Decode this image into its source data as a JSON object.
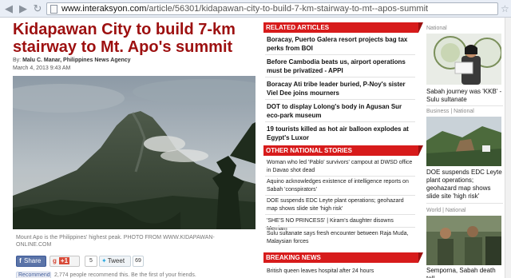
{
  "browser": {
    "url_host": "www.interaksyon.com",
    "url_path": "/article/56301/kidapawan-city-to-build-7-km-stairway-to-mt--apos-summit"
  },
  "article": {
    "headline": "Kidapawan City to build 7-km stairway to Mt. Apo's summit",
    "byline_prefix": "By:",
    "byline_author": "Malu C. Manar, Philippines News Agency",
    "date": "March 4, 2013 9:43 AM",
    "photo_caption": "Mount Apo is the Philippines' highest peak. PHOTO FROM WWW.KIDAPAWAN-ONLINE.COM"
  },
  "social": {
    "fb_share_label": "Share",
    "gplus_label": "+1",
    "gplus_count": "5",
    "tweet_label": "Tweet",
    "tweet_count": "69",
    "recommend_label": "Recommend",
    "recommend_text": "2,774 people recommend this. Be the first of your friends."
  },
  "related": {
    "header": "RELATED ARTICLES",
    "items": [
      "Boracay, Puerto Galera resort projects bag tax perks from BOI",
      "Before Cambodia beats us, airport operations must be privatized - APPI",
      "Boracay Ati tribe leader buried, P-Noy's sister Viel Dee joins mourners",
      "DOT to display Lolong's body in Agusan Sur eco-park museum",
      "19 tourists killed as hot air balloon explodes at Egypt's Luxor"
    ]
  },
  "other_national": {
    "header": "OTHER NATIONAL STORIES",
    "items": [
      "Woman who led 'Pablo' survivors' campout at DWSD office in Davao shot dead",
      "Aquino acknowledges existence of intelligence reports on Sabah 'conspirators'",
      "DOE suspends EDC Leyte plant operations; geohazard map shows slide site 'high risk'",
      "'SHE'S NO PRINCESS' | Kiram's daughter disowns Merriam",
      "Sulu sultanate says fresh encounter between Raja Muda, Malaysian forces"
    ]
  },
  "breaking": {
    "header": "BREAKING NEWS",
    "items": [
      "British queen leaves hospital after 24 hours"
    ]
  },
  "sidebar": {
    "cards": [
      {
        "category": "National",
        "title": "Sabah journey was 'KKB' - Sulu sultanate"
      },
      {
        "category": "Business | National",
        "title": "DOE suspends EDC Leyte plant operations; geohazard map shows slide site 'high risk'"
      },
      {
        "category": "World | National",
        "title": "Semporna, Sabah death toll"
      }
    ]
  },
  "colors": {
    "headline": "#9d1010",
    "section_bar": "#d71b1b"
  }
}
